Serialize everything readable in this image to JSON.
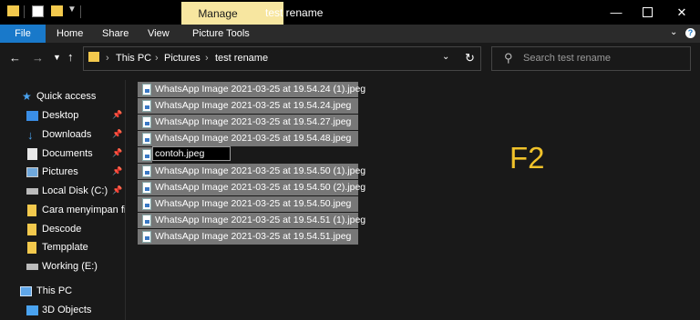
{
  "window": {
    "title": "test rename",
    "context_tab": "Manage"
  },
  "ribbon": {
    "tabs": [
      "File",
      "Home",
      "Share",
      "View",
      "Picture Tools"
    ]
  },
  "address": {
    "crumbs": [
      "This PC",
      "Pictures",
      "test rename"
    ],
    "search_placeholder": "Search test rename"
  },
  "sidebar": {
    "items": [
      {
        "label": "Quick access",
        "icon": "star-icon",
        "pinned": false
      },
      {
        "label": "Desktop",
        "icon": "desktop-icon",
        "pinned": true
      },
      {
        "label": "Downloads",
        "icon": "downloads-icon",
        "pinned": true
      },
      {
        "label": "Documents",
        "icon": "documents-icon",
        "pinned": true
      },
      {
        "label": "Pictures",
        "icon": "pictures-icon",
        "pinned": true
      },
      {
        "label": "Local Disk (C:)",
        "icon": "drive-icon",
        "pinned": true
      },
      {
        "label": "Cara menyimpan fil",
        "icon": "folder-icon",
        "pinned": false
      },
      {
        "label": "Descode",
        "icon": "folder-icon",
        "pinned": false
      },
      {
        "label": "Tempplate",
        "icon": "folder-icon",
        "pinned": false
      },
      {
        "label": "Working (E:)",
        "icon": "drive-icon",
        "pinned": false
      },
      {
        "label": "This PC",
        "icon": "computer-icon",
        "pinned": false
      },
      {
        "label": "3D Objects",
        "icon": "objects-3d-icon",
        "pinned": false
      }
    ]
  },
  "files": [
    "WhatsApp Image 2021-03-25 at 19.54.24 (1).jpeg",
    "WhatsApp Image 2021-03-25 at 19.54.24.jpeg",
    "WhatsApp Image 2021-03-25 at 19.54.27.jpeg",
    "WhatsApp Image 2021-03-25 at 19.54.48.jpeg",
    "",
    "WhatsApp Image 2021-03-25 at 19.54.50 (1).jpeg",
    "WhatsApp Image 2021-03-25 at 19.54.50 (2).jpeg",
    "WhatsApp Image 2021-03-25 at 19.54.50.jpeg",
    "WhatsApp Image 2021-03-25 at 19.54.51 (1).jpeg",
    "WhatsApp Image 2021-03-25 at 19.54.51.jpeg"
  ],
  "rename_value": "contoh.jpeg",
  "overlay_text": "F2",
  "colors": {
    "accent": "#1979ca",
    "manage": "#f7e6a0",
    "overlay": "#f0c22a",
    "selection": "#777777"
  }
}
